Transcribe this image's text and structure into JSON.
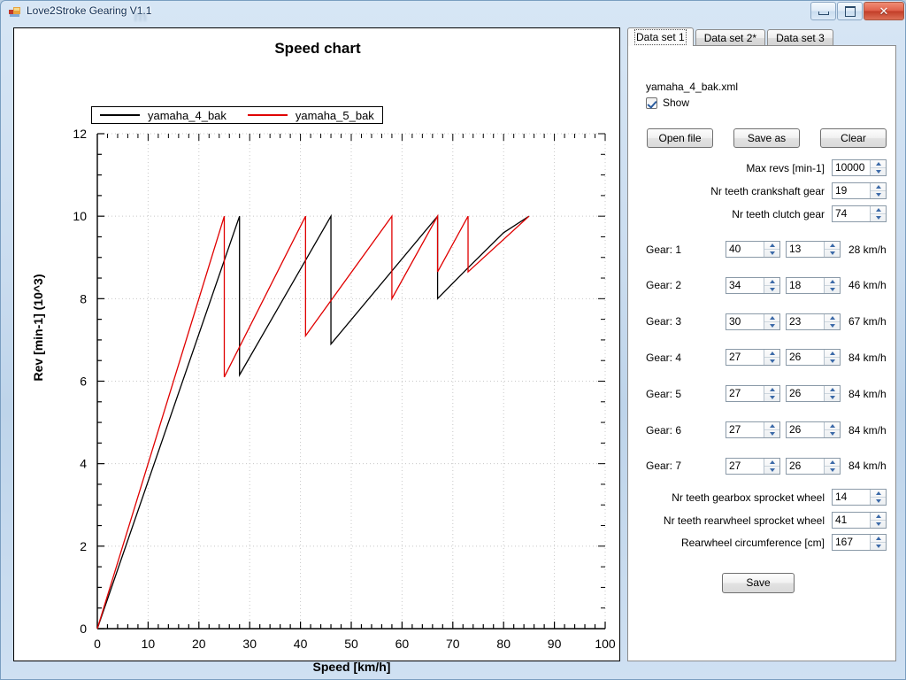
{
  "window": {
    "title": "Love2Stroke Gearing V1.1",
    "ghost": "m",
    "buttons": {
      "minimize": "minimize-icon",
      "maximize": "maximize-icon",
      "close": "✕"
    }
  },
  "chart": {
    "title": "Speed chart",
    "xlabel": "Speed [km/h]",
    "ylabel": "Rev [min-1] (10^3)",
    "legend": [
      {
        "label": "yamaha_4_bak",
        "color": "#000000"
      },
      {
        "label": "yamaha_5_bak",
        "color": "#e00000"
      }
    ],
    "xticks": [
      "0",
      "10",
      "20",
      "30",
      "40",
      "50",
      "60",
      "70",
      "80",
      "90",
      "100"
    ],
    "yticks": [
      "0",
      "2",
      "4",
      "6",
      "8",
      "10",
      "12"
    ]
  },
  "chart_data": {
    "type": "line",
    "title": "Speed chart",
    "xlabel": "Speed [km/h]",
    "ylabel": "Rev [min-1] (10^3)",
    "xlim": [
      0,
      100
    ],
    "ylim": [
      0,
      12
    ],
    "xticks": [
      0,
      10,
      20,
      30,
      40,
      50,
      60,
      70,
      80,
      90,
      100
    ],
    "yticks": [
      0,
      2,
      4,
      6,
      8,
      10,
      12
    ],
    "xminor_step": 2,
    "yminor_step": 0.5,
    "grid": "dotted",
    "legend_position": "top-left-above-axes",
    "series": [
      {
        "name": "yamaha_4_bak",
        "color": "#000000",
        "description": "7-gear sawtooth: revs rise linearly with speed in each gear then drop at shift point",
        "segments": [
          {
            "gear": 1,
            "points": [
              [
                0,
                0
              ],
              [
                28,
                10
              ]
            ]
          },
          {
            "gear": 2,
            "points": [
              [
                28,
                6.15
              ],
              [
                46,
                10
              ]
            ]
          },
          {
            "gear": 3,
            "points": [
              [
                46,
                6.9
              ],
              [
                67,
                10
              ]
            ]
          },
          {
            "gear": 4,
            "points": [
              [
                67,
                8.0
              ],
              [
                73,
                8.75
              ]
            ]
          },
          {
            "gear": 5,
            "points": [
              [
                73,
                8.75
              ],
              [
                80,
                9.6
              ]
            ]
          },
          {
            "gear": 6,
            "points": [
              [
                80,
                9.6
              ],
              [
                85,
                10
              ]
            ]
          },
          {
            "gear": 7,
            "points": [
              [
                85,
                10
              ],
              [
                85,
                10
              ]
            ]
          }
        ]
      },
      {
        "name": "yamaha_5_bak",
        "color": "#e00000",
        "description": "7-gear sawtooth with shorter first gear ratio",
        "segments": [
          {
            "gear": 1,
            "points": [
              [
                0,
                0
              ],
              [
                25,
                10
              ]
            ]
          },
          {
            "gear": 2,
            "points": [
              [
                25,
                6.1
              ],
              [
                41,
                10
              ]
            ]
          },
          {
            "gear": 3,
            "points": [
              [
                41,
                7.1
              ],
              [
                58,
                10
              ]
            ]
          },
          {
            "gear": 4,
            "points": [
              [
                58,
                8.0
              ],
              [
                67,
                10
              ]
            ]
          },
          {
            "gear": 5,
            "points": [
              [
                67,
                8.65
              ],
              [
                73,
                10
              ]
            ]
          },
          {
            "gear": 6,
            "points": [
              [
                73,
                8.65
              ],
              [
                85,
                10
              ]
            ]
          },
          {
            "gear": 7,
            "points": [
              [
                85,
                10
              ],
              [
                85,
                10
              ]
            ]
          }
        ]
      }
    ]
  },
  "tabs": [
    {
      "label": "Data set 1",
      "active": true
    },
    {
      "label": "Data set 2*",
      "active": false
    },
    {
      "label": "Data set 3",
      "active": false
    }
  ],
  "panel": {
    "filename": "yamaha_4_bak.xml",
    "show_label": "Show",
    "show_checked": true,
    "open_file": "Open file",
    "save_as": "Save as",
    "clear": "Clear",
    "save": "Save",
    "fields": [
      {
        "label": "Max revs [min-1]",
        "value": "10000"
      },
      {
        "label": "Nr teeth crankshaft gear",
        "value": "19"
      },
      {
        "label": "Nr teeth clutch gear",
        "value": "74"
      }
    ],
    "gears": [
      {
        "label": "Gear: 1",
        "a": "40",
        "b": "13",
        "speed": "28 km/h"
      },
      {
        "label": "Gear: 2",
        "a": "34",
        "b": "18",
        "speed": "46 km/h"
      },
      {
        "label": "Gear: 3",
        "a": "30",
        "b": "23",
        "speed": "67 km/h"
      },
      {
        "label": "Gear: 4",
        "a": "27",
        "b": "26",
        "speed": "84 km/h"
      },
      {
        "label": "Gear: 5",
        "a": "27",
        "b": "26",
        "speed": "84 km/h"
      },
      {
        "label": "Gear: 6",
        "a": "27",
        "b": "26",
        "speed": "84 km/h"
      },
      {
        "label": "Gear: 7",
        "a": "27",
        "b": "26",
        "speed": "84 km/h"
      }
    ],
    "bottom_fields": [
      {
        "label": "Nr teeth gearbox sprocket wheel",
        "value": "14"
      },
      {
        "label": "Nr teeth rearwheel sprocket wheel",
        "value": "41"
      },
      {
        "label": "Rearwheel circumference [cm]",
        "value": "167"
      }
    ]
  }
}
